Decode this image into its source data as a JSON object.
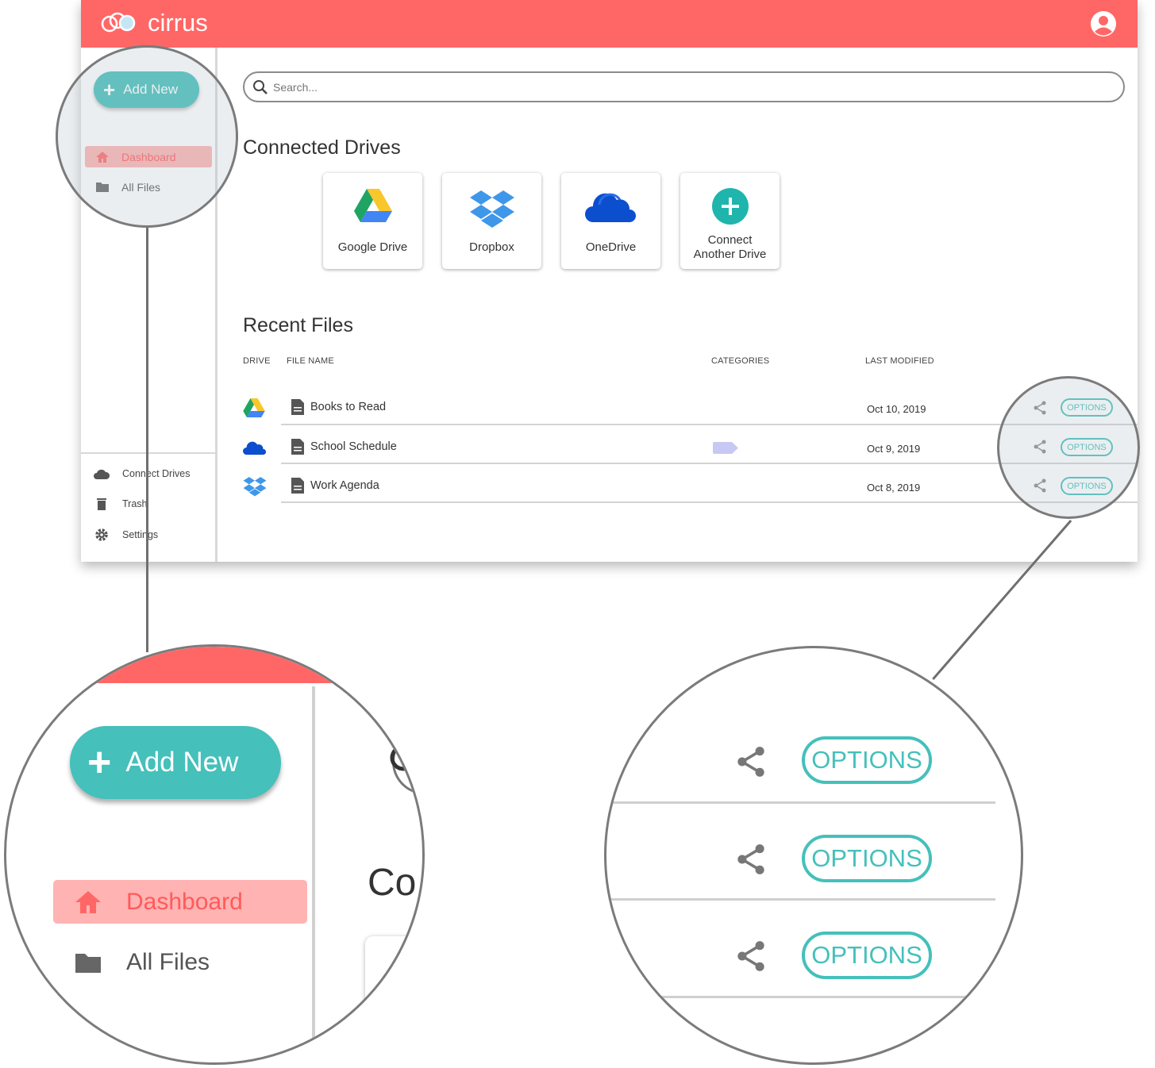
{
  "app": {
    "brand_name": "cirrus",
    "colors": {
      "header": "#ff6766",
      "accent": "#45c0bb",
      "active_nav_bg": "#ffb3b3",
      "active_nav_text": "#ff5a5a"
    }
  },
  "header": {
    "user_icon": "user-circle-icon"
  },
  "sidebar": {
    "add_new_label": "Add New",
    "nav": [
      {
        "label": "Dashboard",
        "icon": "home-icon",
        "active": true
      },
      {
        "label": "All Files",
        "icon": "folder-icon",
        "active": false
      }
    ],
    "bottom": [
      {
        "label": "Connect Drives",
        "icon": "cloud-icon"
      },
      {
        "label": "Trash",
        "icon": "trash-icon"
      },
      {
        "label": "Settings",
        "icon": "gear-icon"
      }
    ]
  },
  "search": {
    "placeholder": "Search..."
  },
  "connected_drives": {
    "title": "Connected Drives",
    "cards": [
      {
        "label": "Google Drive",
        "icon": "google-drive-icon"
      },
      {
        "label": "Dropbox",
        "icon": "dropbox-icon"
      },
      {
        "label": "OneDrive",
        "icon": "onedrive-icon"
      },
      {
        "label_line1": "Connect",
        "label_line2": "Another Drive",
        "icon": "plus-circle-icon"
      }
    ]
  },
  "recent_files": {
    "title": "Recent Files",
    "columns": {
      "drive": "DRIVE",
      "file_name": "FILE NAME",
      "categories": "CATEGORIES",
      "last_modified": "LAST MODIFIED"
    },
    "rows": [
      {
        "drive": "google-drive-icon",
        "name": "Books to Read",
        "category": "",
        "modified": "Oct 10, 2019",
        "options": "OPTIONS"
      },
      {
        "drive": "onedrive-icon",
        "name": "School Schedule",
        "category": "tag",
        "modified": "Oct 9, 2019",
        "options": "OPTIONS"
      },
      {
        "drive": "dropbox-icon",
        "name": "Work Agenda",
        "category": "",
        "modified": "Oct 8, 2019",
        "options": "OPTIONS"
      }
    ]
  },
  "zoom_left": {
    "add_new_label": "Add New",
    "nav": [
      {
        "label": "Dashboard"
      },
      {
        "label": "All Files"
      }
    ],
    "partial_title": "Co"
  },
  "zoom_right": {
    "options": [
      "OPTIONS",
      "OPTIONS",
      "OPTIONS"
    ]
  }
}
